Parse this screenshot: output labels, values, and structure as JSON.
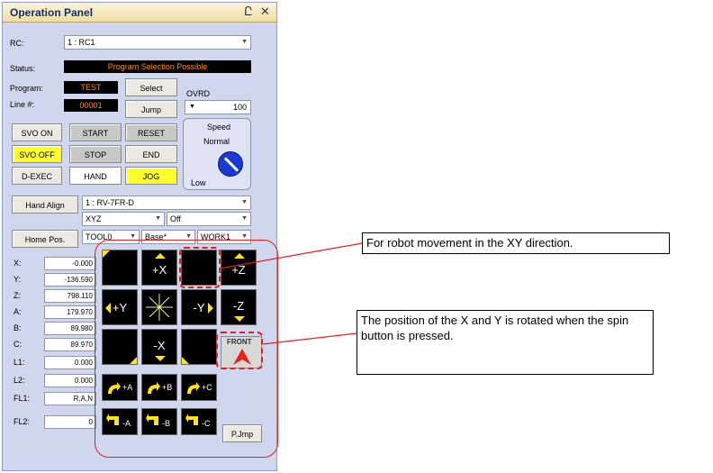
{
  "panel": {
    "title": "Operation Panel",
    "pin_glyph": "Ը",
    "close_glyph": "✕"
  },
  "rc": {
    "label": "RC:",
    "value": "1 : RC1"
  },
  "status": {
    "label": "Status:",
    "value": "Program Selection Possible"
  },
  "program": {
    "label": "Program:",
    "value": "TEST"
  },
  "line": {
    "label": "Line #:",
    "value": "00001"
  },
  "buttons": {
    "select": "Select",
    "jump": "Jump",
    "svo_on": "SVO ON",
    "svo_off": "SVO OFF",
    "d_exec": "D-EXEC",
    "start": "START",
    "stop": "STOP",
    "hand": "HAND",
    "reset": "RESET",
    "end": "END",
    "jog": "JOG",
    "hand_align": "Hand Align",
    "home_pos": "Home Pos.",
    "pjmp": "P.Jmp"
  },
  "ovrd": {
    "label": "OVRD",
    "value": "100"
  },
  "speed": {
    "title": "Speed",
    "mode": "Normal",
    "low": "Low"
  },
  "robot": {
    "value": "1 : RV-7FR-D"
  },
  "jog_mode": {
    "value": "XYZ"
  },
  "off_select": {
    "value": "Off"
  },
  "tool": {
    "value": "TOOL0"
  },
  "base": {
    "value": "Base*"
  },
  "work": {
    "value": "WORK1"
  },
  "positions": [
    {
      "label": "X:",
      "value": "-0.000"
    },
    {
      "label": "Y:",
      "value": "-136.590"
    },
    {
      "label": "Z:",
      "value": "798.110"
    },
    {
      "label": "A:",
      "value": "179.970"
    },
    {
      "label": "B:",
      "value": "89.980"
    },
    {
      "label": "C:",
      "value": "89.970"
    },
    {
      "label": "L1:",
      "value": "0.000"
    },
    {
      "label": "L2:",
      "value": "0.000"
    },
    {
      "label": "FL1:",
      "value": "R,A,N"
    },
    {
      "label": "FL2:",
      "value": "0"
    }
  ],
  "jog_keys": {
    "plus_x": "+X",
    "minus_x": "-X",
    "plus_y": "+Y",
    "minus_y": "-Y",
    "plus_z": "+Z",
    "minus_z": "-Z",
    "plus_a": "+A",
    "plus_b": "+B",
    "plus_c": "+C",
    "minus_a": "-A",
    "minus_b": "-B",
    "minus_c": "-C",
    "front": "FRONT"
  },
  "callouts": {
    "xy": "For robot movement in the XY direction.",
    "rotate": "The position of the X and Y is rotated when the spin button is pressed."
  },
  "colors": {
    "highlight": "#e02020",
    "jog_yellow": "#ffe21a",
    "status_text": "#ff8c1a"
  }
}
